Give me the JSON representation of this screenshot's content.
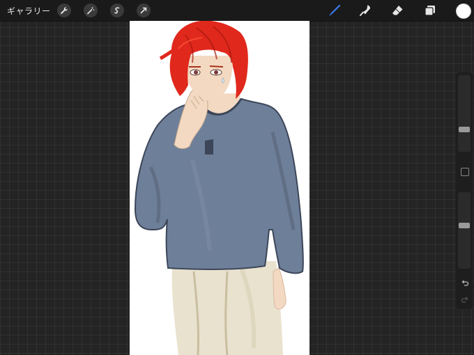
{
  "topbar": {
    "gallery_label": "ギャラリー",
    "left_tools": [
      "wrench-icon",
      "magic-wand-icon",
      "selection-icon",
      "transform-arrow-icon"
    ],
    "right_tools": [
      "brush-icon",
      "smudge-icon",
      "eraser-icon",
      "layers-icon"
    ],
    "active_tool": "brush-icon",
    "current_color": "#ffffff"
  },
  "sidebar": {
    "brush_size": 0.27,
    "opacity": 0.57,
    "buttons": [
      "modify-square-icon",
      "undo-icon",
      "redo-icon"
    ]
  },
  "colors": {
    "background": "#242424",
    "topbar": "#1a1a1a",
    "canvas": "#ffffff",
    "accent": "#3a7cf0",
    "hair": "#e0281c",
    "sweater": "#6e7f99",
    "pants": "#e9e2cf",
    "skin": "#f3d9c2"
  }
}
